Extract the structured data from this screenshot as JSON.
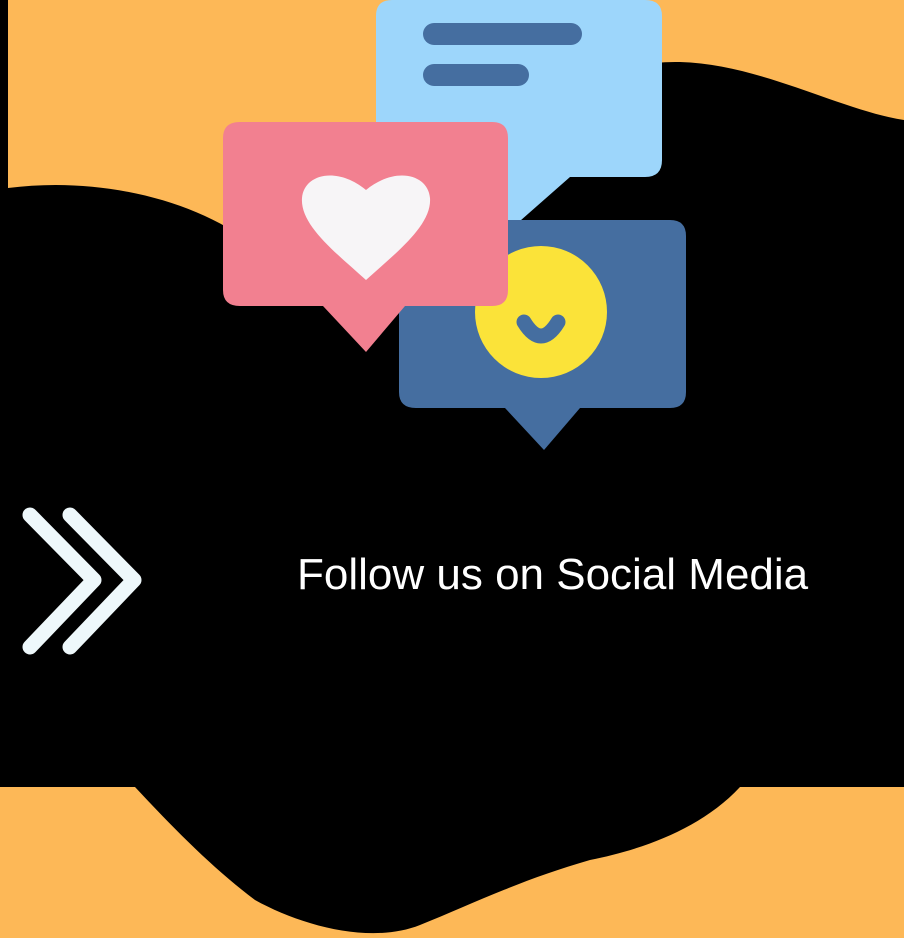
{
  "headline": "Follow us on Social Media",
  "colors": {
    "background": "#fdb857",
    "blob": "#000000",
    "message_bubble": "#9dd6fb",
    "message_lines": "#456ea0",
    "heart_bubble": "#f28090",
    "heart": "#f7f5f7",
    "smiley_bubble": "#456ea0",
    "smiley_face": "#fbe339",
    "chevrons": "#eef8fb",
    "headline_text": "#ffffff"
  },
  "icons": {
    "message_bubble": "message-bubble-icon",
    "heart_bubble": "heart-bubble-icon",
    "smiley_bubble": "smiley-bubble-icon",
    "chevrons": "double-chevron-right-icon"
  }
}
